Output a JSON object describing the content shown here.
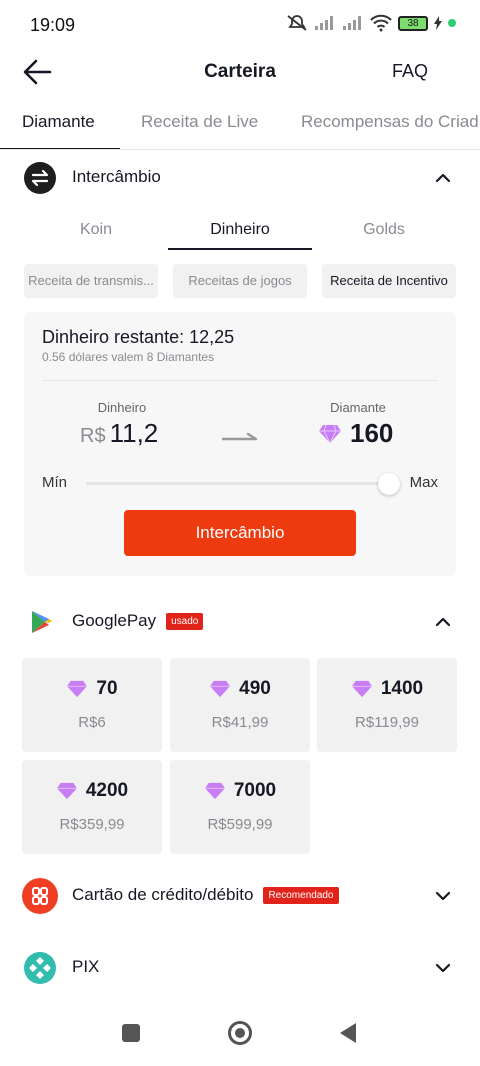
{
  "status": {
    "time": "19:09",
    "battery": "38"
  },
  "header": {
    "title": "Carteira",
    "faq": "FAQ"
  },
  "main_tabs": [
    {
      "label": "Diamante"
    },
    {
      "label": "Receita de Live"
    },
    {
      "label": "Recompensas do Criad"
    }
  ],
  "exchange_section": {
    "title": "Intercâmbio",
    "sub_tabs": [
      {
        "label": "Koin"
      },
      {
        "label": "Dinheiro"
      },
      {
        "label": "Golds"
      }
    ],
    "chips": [
      {
        "label": "Receita de transmis..."
      },
      {
        "label": "Receitas de jogos"
      },
      {
        "label": "Receita de Incentivo"
      }
    ],
    "remaining": "Dinheiro restante: 12,25",
    "rate": "0.56 dólares valem 8 Diamantes",
    "money_label": "Dinheiro",
    "money_currency": "R$",
    "money_value": "11,2",
    "diamond_label": "Diamante",
    "diamond_value": "160",
    "min_label": "Mín",
    "max_label": "Max",
    "slider_fraction": 0.95,
    "button": "Intercâmbio"
  },
  "googlepay": {
    "title": "GooglePay",
    "badge": "usado",
    "packages": [
      {
        "amount": "70",
        "price": "R$6"
      },
      {
        "amount": "490",
        "price": "R$41,99"
      },
      {
        "amount": "1400",
        "price": "R$119,99"
      },
      {
        "amount": "4200",
        "price": "R$359,99"
      },
      {
        "amount": "7000",
        "price": "R$599,99"
      }
    ]
  },
  "card_payment": {
    "title": "Cartão de crédito/débito",
    "badge": "Recomendado"
  },
  "pix": {
    "title": "PIX"
  },
  "colors": {
    "accent": "#ee3a0f",
    "badge": "#e2231a",
    "card_icon": "#ef3e23",
    "pix_icon": "#32bcad",
    "diamond": "#c77df3"
  }
}
